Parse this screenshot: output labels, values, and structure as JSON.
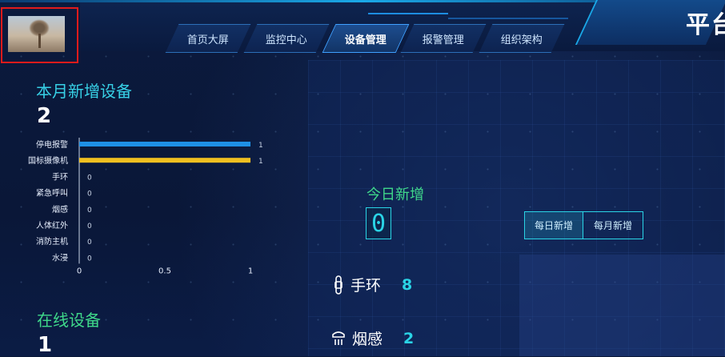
{
  "header": {
    "title": "平台",
    "tabs": [
      {
        "label": "首页大屏",
        "active": false
      },
      {
        "label": "监控中心",
        "active": false
      },
      {
        "label": "设备管理",
        "active": true
      },
      {
        "label": "报警管理",
        "active": false
      },
      {
        "label": "组织架构",
        "active": false
      }
    ]
  },
  "left": {
    "new_devices_title": "本月新增设备",
    "new_devices_count": "2",
    "online_title": "在线设备",
    "online_count": "1"
  },
  "chart_data": {
    "type": "bar",
    "orientation": "horizontal",
    "categories": [
      "停电报警",
      "国标摄像机",
      "手环",
      "紧急呼叫",
      "烟感",
      "人体红外",
      "消防主机",
      "水浸"
    ],
    "values": [
      1,
      1,
      0,
      0,
      0,
      0,
      0,
      0
    ],
    "bar_colors": [
      "#1e90e6",
      "#f0c020"
    ],
    "xlim": [
      0,
      1
    ],
    "xticks": [
      "0",
      "0.5",
      "1"
    ],
    "grid": false
  },
  "today": {
    "title": "今日新增",
    "value": "0",
    "toggle": [
      "每日新增",
      "每月新增"
    ]
  },
  "stats": [
    {
      "icon": "bracelet-icon",
      "label": "手环",
      "value": "8"
    },
    {
      "icon": "smoke-detector-icon",
      "label": "烟感",
      "value": "2"
    }
  ],
  "colors": {
    "accent": "#2ad4e6",
    "green": "#3fd88a",
    "highlight_box": "#e01b1b"
  }
}
